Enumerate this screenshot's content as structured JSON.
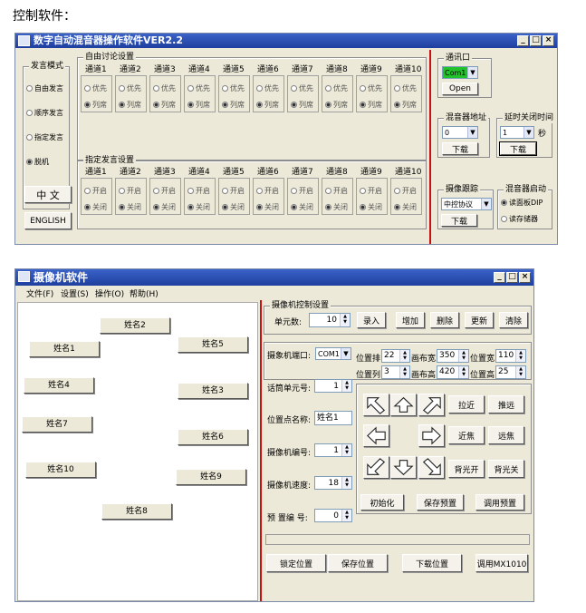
{
  "caption": "控制软件：",
  "win1": {
    "title": "数字自动混音器操作软件VER2.2",
    "speak_mode": {
      "label": "发言模式",
      "options": [
        "自由发言",
        "顺序发言",
        "指定发言",
        "脱机"
      ],
      "selected": 3
    },
    "btn_chinese": "中 文",
    "btn_english": "ENGLISH",
    "free_group": {
      "label": "自由讨论设置",
      "channels": [
        "通道1",
        "通道2",
        "通道3",
        "通道4",
        "通道5",
        "通道6",
        "通道7",
        "通道8",
        "通道9",
        "通道10"
      ],
      "opt_a": "优先",
      "opt_b": "列席"
    },
    "assign_group": {
      "label": "指定发言设置",
      "channels": [
        "通道1",
        "通道2",
        "通道3",
        "通道4",
        "通道5",
        "通道6",
        "通道7",
        "通道8",
        "通道9",
        "通道10"
      ],
      "opt_a": "开启",
      "opt_b": "关闭"
    },
    "comm": {
      "label": "通讯口",
      "port": "Com1",
      "open": "Open",
      "port_color": "#22c32a"
    },
    "mixer_addr": {
      "label": "混音器地址",
      "value": "0",
      "download": "下载"
    },
    "delay": {
      "label": "延时关闭时间",
      "value": "1",
      "unit": "秒",
      "download": "下载"
    },
    "camera_track": {
      "label": "摄像跟踪",
      "value": "中控协议",
      "download": "下载"
    },
    "mixer_start": {
      "label": "混音器启动",
      "opt_a": "读面板DIP",
      "opt_b": "读存储器"
    }
  },
  "win2": {
    "title": "摄像机软件",
    "menu": [
      "文件(F)",
      "设置(S)",
      "操作(O)",
      "帮助(H)"
    ],
    "names": [
      "姓名2",
      "姓名1",
      "姓名5",
      "姓名4",
      "姓名3",
      "姓名7",
      "姓名6",
      "姓名10",
      "姓名9",
      "姓名8"
    ],
    "ctrl": {
      "label": "摄像机控制设置",
      "unit_count_label": "单元数:",
      "unit_count": "10",
      "btn_row1": [
        "录入",
        "增加",
        "删除",
        "更新",
        "清除"
      ],
      "cam_port_label": "摄象机端口:",
      "cam_port": "COM1",
      "pos_row_label": "位置排",
      "pos_row": "22",
      "width_label": "画布宽",
      "width": "350",
      "pos_w_label": "位置宽",
      "pos_w": "110",
      "pos_col_label": "位置列",
      "pos_col": "3",
      "height_label": "画布高",
      "height": "420",
      "pos_h_label": "位置高",
      "pos_h": "25",
      "mic_unit_label": "话筒单元号:",
      "mic_unit": "1",
      "pos_name_label": "位置点名称:",
      "pos_name": "姓名1",
      "cam_no_label": "摄像机编号:",
      "cam_no": "1",
      "cam_speed_label": "摄像机速度:",
      "cam_speed": "18",
      "preset_label": "预 置编 号:",
      "preset": "0",
      "lens_btns": [
        "拉近",
        "推远",
        "近焦",
        "远焦",
        "背光开",
        "背光关"
      ],
      "init": "初始化",
      "save_preset": "保存预置",
      "call_preset": "调用预置",
      "bottom_btns": [
        "锁定位置",
        "保存位置",
        "下载位置",
        "调用MX1010"
      ]
    }
  }
}
